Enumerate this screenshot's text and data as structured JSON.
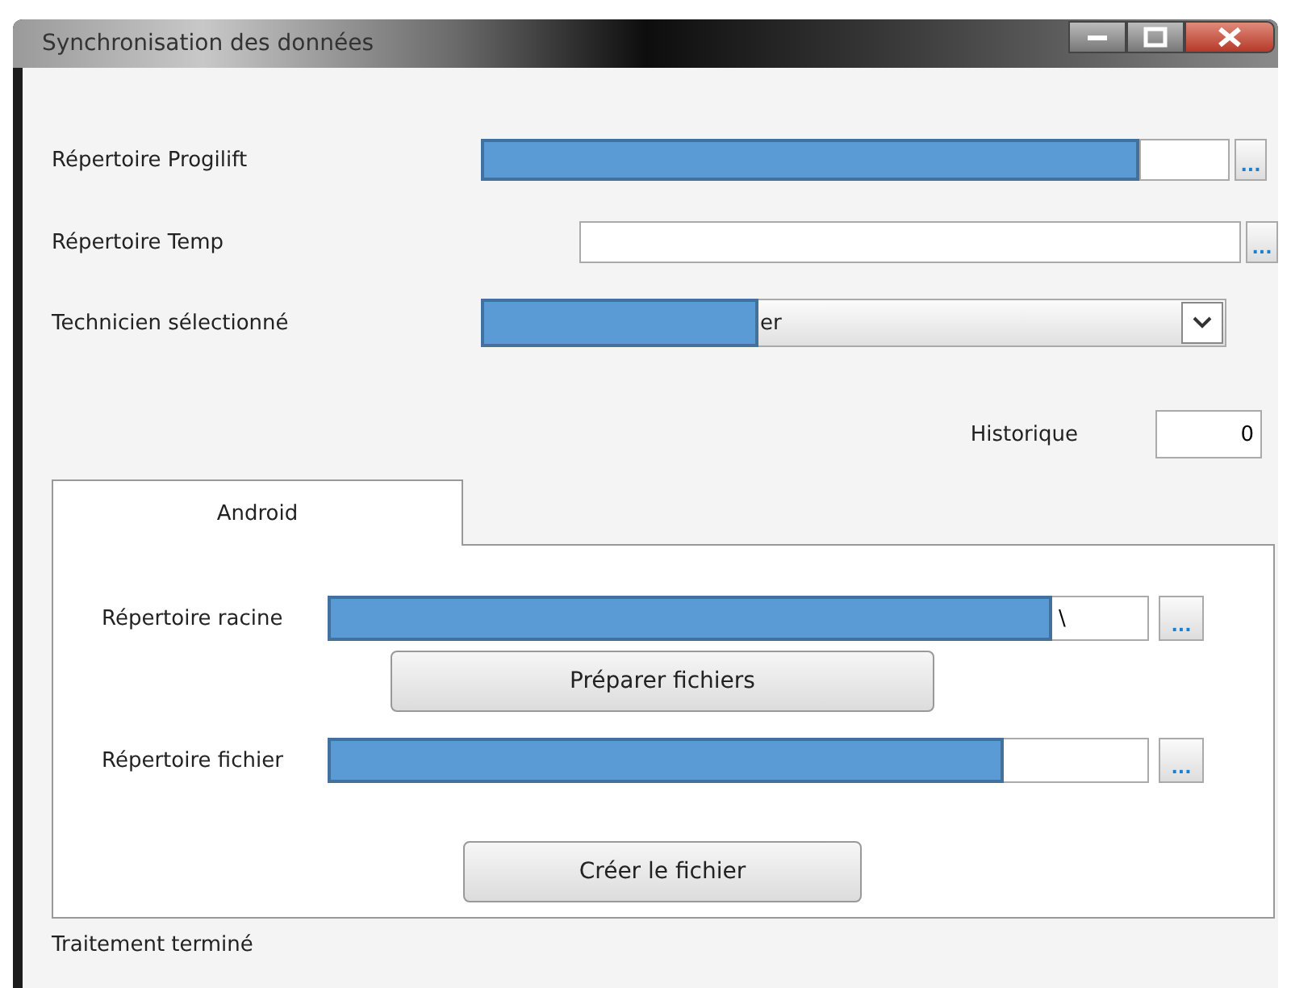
{
  "window": {
    "title": "Synchronisation des données"
  },
  "settings": [
    {
      "kind": "path",
      "label": "Répertoire Progilift",
      "redacted": true,
      "browse": "..."
    },
    {
      "kind": "path",
      "label": "Répertoire Temp",
      "browse": "..."
    },
    {
      "kind": "combo",
      "label": "Technicien sélectionné",
      "value": "er",
      "redacted": true
    }
  ],
  "history": {
    "label": "Historique",
    "value": "0"
  },
  "tabs": [
    {
      "label": "Android",
      "selected": true
    }
  ],
  "android": [
    {
      "label": "Répertoire racine",
      "value": "\\",
      "redacted": true,
      "browse": "...",
      "button": "Préparer fichiers"
    },
    {
      "label": "Répertoire fichier",
      "redacted": true,
      "browse": "...",
      "button": "Créer le fichier"
    }
  ],
  "status_bar": "Traitement terminé"
}
